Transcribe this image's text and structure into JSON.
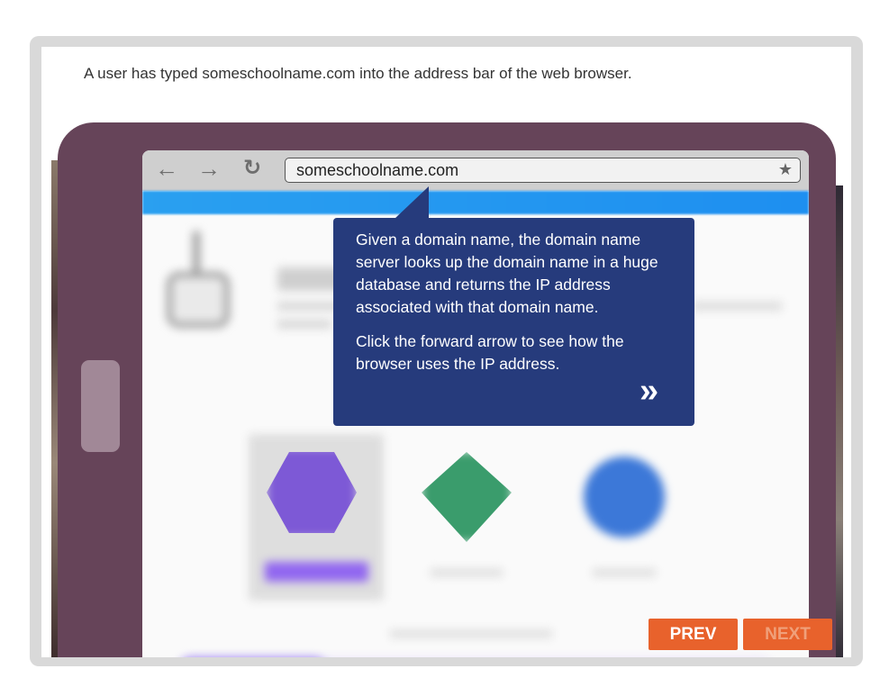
{
  "intro_text": "A user has typed someschoolname.com into the address bar of the web browser.",
  "browser": {
    "address_value": "someschoolname.com",
    "back_icon": "arrow-left-icon",
    "forward_icon": "arrow-right-icon",
    "reload_icon": "reload-icon",
    "bookmark_icon": "star-icon"
  },
  "callout": {
    "paragraph1": "Given a domain name, the domain name server looks up the domain name in a huge database and returns the IP address associated with that domain name.",
    "paragraph2": "Click the forward arrow to see how the browser uses the IP address.",
    "forward_icon": "double-chevron-right-icon"
  },
  "nav": {
    "prev_label": "PREV",
    "next_label": "NEXT"
  },
  "colors": {
    "tablet": "#664459",
    "callout": "#263b7c",
    "button": "#e8622c",
    "frame": "#d9d9d9"
  }
}
